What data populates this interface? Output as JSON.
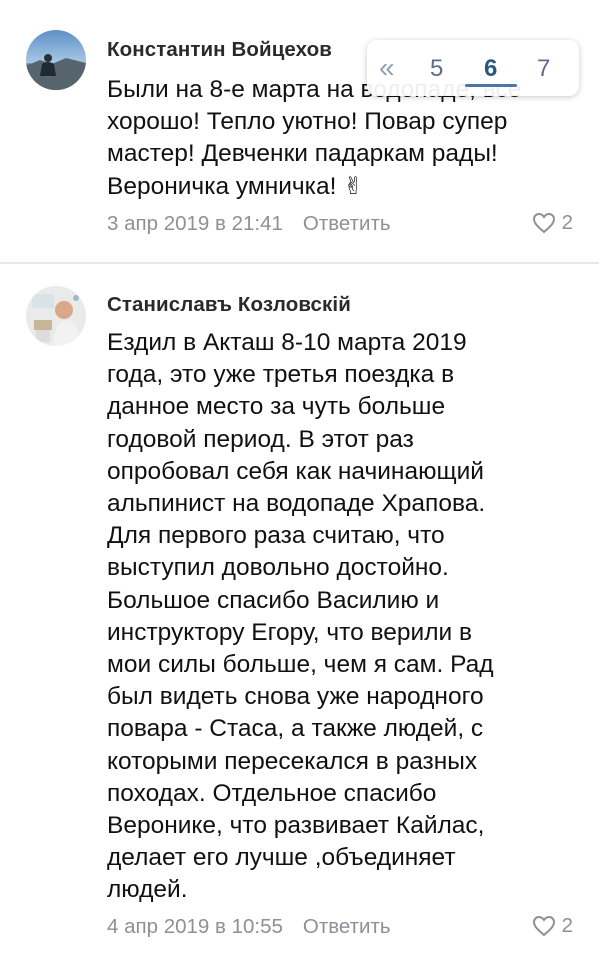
{
  "comments": [
    {
      "author": "Константин Войцехов",
      "text_lines": [
        "Были на 8-е марта на водопаде, всё",
        "хорошо! Тепло уютно! Повар супер",
        "мастер! Девченки падаркам рады!",
        "Вероничка умничка!"
      ],
      "emoji": "✌",
      "date": "3 апр 2019 в 21:41",
      "reply_label": "Ответить",
      "likes": "2"
    },
    {
      "author": "Станиславъ Козловскій",
      "text_lines": [
        "Ездил в Акташ 8-10 марта 2019",
        "года, это уже третья поездка в",
        "данное место за чуть больше",
        "годовой период. В этот раз",
        "опробовал себя как начинающий",
        "альпинист на водопаде Храпова.",
        "Для первого раза считаю, что",
        "выступил довольно достойно.",
        "Большое спасибо Василию и",
        "инструктору Егору, что верили в",
        "мои силы больше, чем я сам. Рад",
        "был видеть снова уже народного",
        "повара - Стаса, а также людей, с",
        "которыми пересекался в разных",
        "походах. Отдельное спасибо",
        "Веронике, что развивает Кайлас,",
        "делает его лучше ,объединяет",
        "людей."
      ],
      "date": "4 апр 2019 в 10:55",
      "reply_label": "Ответить",
      "likes": "2"
    }
  ],
  "pagination": {
    "prev_icon": "«",
    "pages": [
      "5",
      "6",
      "7"
    ],
    "current": "6"
  },
  "colors": {
    "meta_gray": "#8a9198",
    "accent_blue": "#4a76a8",
    "divider": "#e7e8ec"
  },
  "icons": [
    "heart-outline-icon",
    "double-chevron-left-icon"
  ]
}
